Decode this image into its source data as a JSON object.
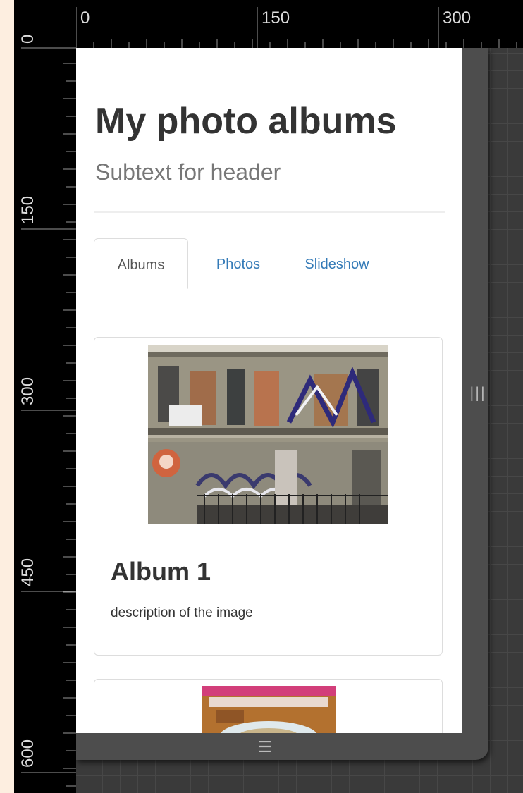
{
  "ruler": {
    "top_labels": [
      "0",
      "150",
      "300"
    ],
    "left_labels": [
      "0",
      "150",
      "300",
      "450",
      "600"
    ]
  },
  "header": {
    "title": "My photo albums",
    "subtext": "Subtext for header"
  },
  "tabs": [
    {
      "label": "Albums",
      "active": true
    },
    {
      "label": "Photos",
      "active": false
    },
    {
      "label": "Slideshow",
      "active": false
    }
  ],
  "albums": [
    {
      "title": "Album 1",
      "description": "description of the image",
      "image": "graffiti-building-photo"
    },
    {
      "title": "",
      "description": "",
      "image": "food-plate-photo"
    }
  ],
  "icons": {
    "resize_right": "vertical-resize-handle-icon",
    "resize_bottom": "horizontal-resize-handle-icon"
  },
  "colors": {
    "link": "#337ab7",
    "text": "#333333",
    "muted": "#777777",
    "ruler_bg": "#000000",
    "canvas_bg": "#3a3a3a"
  }
}
